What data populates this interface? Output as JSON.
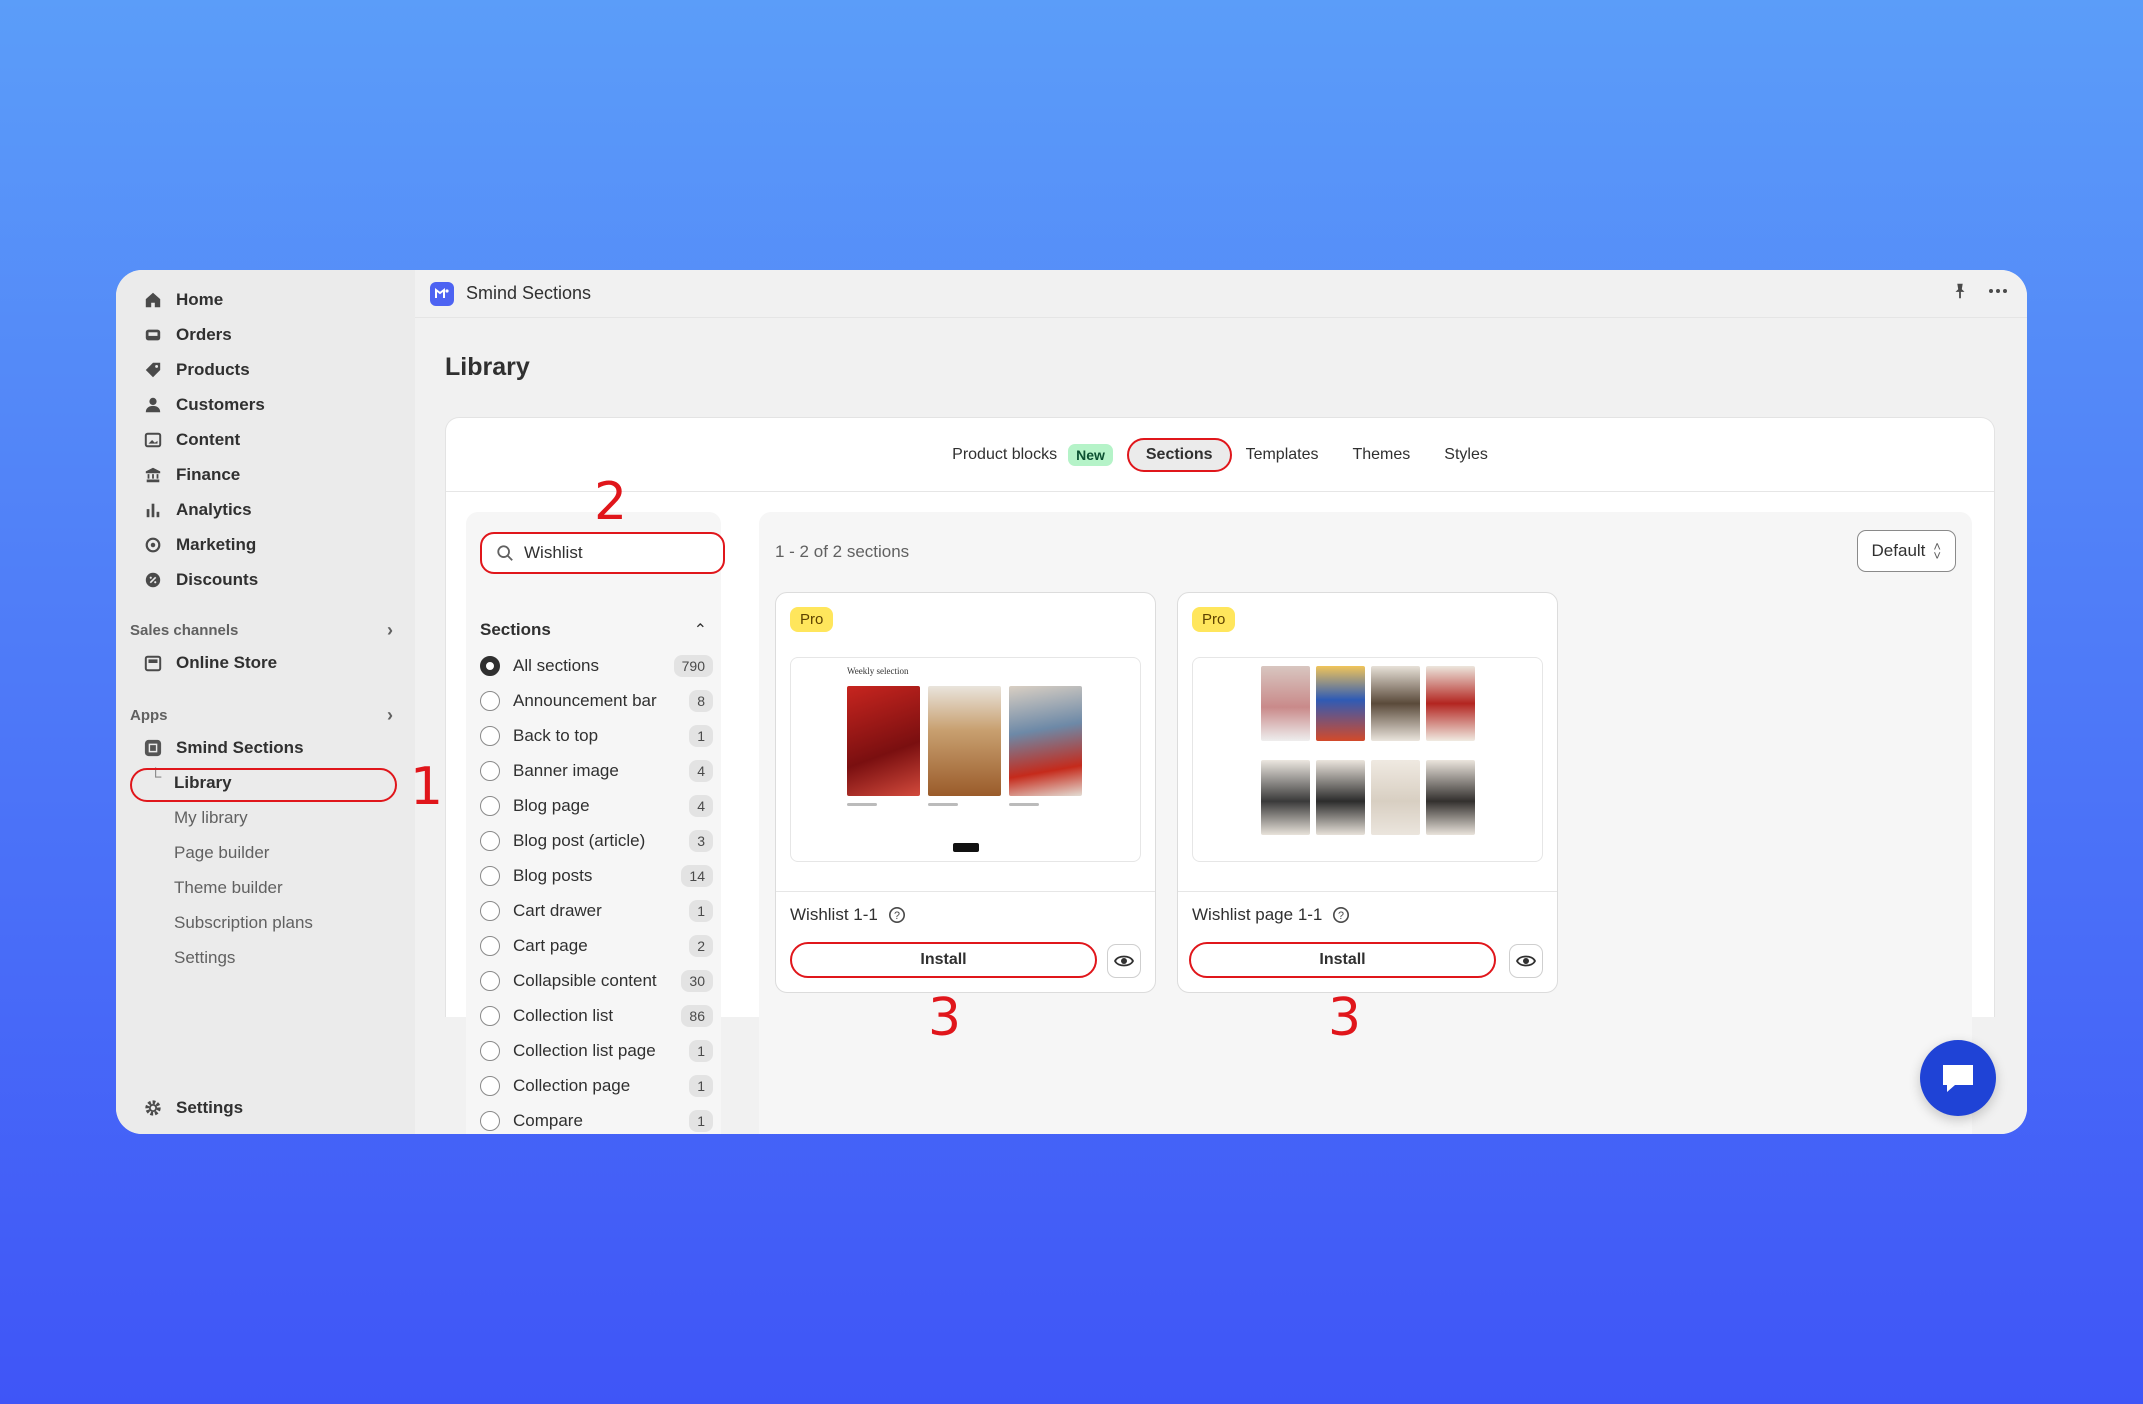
{
  "sidebar": {
    "items": [
      {
        "label": "Home",
        "icon": "home-icon"
      },
      {
        "label": "Orders",
        "icon": "inbox-icon"
      },
      {
        "label": "Products",
        "icon": "tag-icon"
      },
      {
        "label": "Customers",
        "icon": "person-icon"
      },
      {
        "label": "Content",
        "icon": "image-icon"
      },
      {
        "label": "Finance",
        "icon": "bank-icon"
      },
      {
        "label": "Analytics",
        "icon": "bar-chart-icon"
      },
      {
        "label": "Marketing",
        "icon": "target-icon"
      },
      {
        "label": "Discounts",
        "icon": "discount-icon"
      }
    ],
    "sales_channels_label": "Sales channels",
    "online_store_label": "Online Store",
    "apps_label": "Apps",
    "app_name": "Smind Sections",
    "app_sub": [
      "Library",
      "My library",
      "Page builder",
      "Theme builder",
      "Subscription plans",
      "Settings"
    ],
    "settings_label": "Settings"
  },
  "topbar": {
    "app_title": "Smind Sections"
  },
  "page": {
    "title": "Library"
  },
  "tabs": {
    "product_blocks": "Product blocks",
    "new_badge": "New",
    "sections": "Sections",
    "templates": "Templates",
    "themes": "Themes",
    "styles": "Styles",
    "active": "Sections"
  },
  "search": {
    "value": "Wishlist"
  },
  "filter": {
    "heading": "Sections",
    "items": [
      {
        "label": "All sections",
        "count": "790",
        "selected": true
      },
      {
        "label": "Announcement bar",
        "count": "8"
      },
      {
        "label": "Back to top",
        "count": "1"
      },
      {
        "label": "Banner image",
        "count": "4"
      },
      {
        "label": "Blog page",
        "count": "4"
      },
      {
        "label": "Blog post (article)",
        "count": "3"
      },
      {
        "label": "Blog posts",
        "count": "14"
      },
      {
        "label": "Cart drawer",
        "count": "1"
      },
      {
        "label": "Cart page",
        "count": "2"
      },
      {
        "label": "Collapsible content",
        "count": "30"
      },
      {
        "label": "Collection list",
        "count": "86"
      },
      {
        "label": "Collection list page",
        "count": "1"
      },
      {
        "label": "Collection page",
        "count": "1"
      },
      {
        "label": "Compare",
        "count": "1"
      }
    ]
  },
  "results": {
    "count_text": "1 - 2 of 2 sections",
    "sort_label": "Default"
  },
  "products": [
    {
      "badge": "Pro",
      "name": "Wishlist 1-1",
      "install": "Install",
      "thumb_title": "Weekly selection"
    },
    {
      "badge": "Pro",
      "name": "Wishlist page 1-1",
      "install": "Install"
    }
  ],
  "annotations": [
    "1",
    "2",
    "3",
    "3"
  ],
  "colors": {
    "accent_red": "#e0161b",
    "brand_blue": "#4d63f2",
    "chat_blue": "#1f43d6",
    "pro_yellow": "#ffe65c",
    "new_green": "#b5f3c8"
  }
}
